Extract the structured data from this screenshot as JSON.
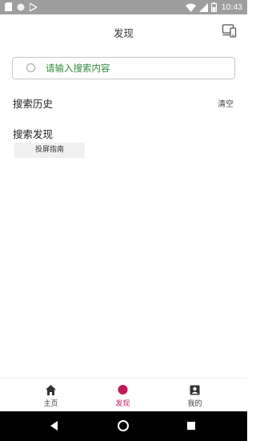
{
  "status_bar": {
    "time": "10:43",
    "left_icons": [
      "sd-card-icon",
      "circle-icon",
      "play-store-icon"
    ],
    "right_icons": [
      "wifi-icon",
      "signal-icon",
      "battery-icon"
    ]
  },
  "header": {
    "title": "发现",
    "action_icon": "cast-screen-icon"
  },
  "search": {
    "placeholder": "请输入搜索内容",
    "value": ""
  },
  "history": {
    "title": "搜索历史",
    "clear_label": "清空"
  },
  "discover": {
    "title": "搜索发现",
    "tags": [
      "投屏指南"
    ]
  },
  "bottom_nav": {
    "items": [
      {
        "label": "主页",
        "icon": "home-icon",
        "active": false
      },
      {
        "label": "发现",
        "icon": "discover-dot-icon",
        "active": true
      },
      {
        "label": "我的",
        "icon": "profile-icon",
        "active": false
      }
    ]
  },
  "colors": {
    "accent": "#c2185b",
    "placeholder_green": "#2e8b3a",
    "status_bar": "#9e9e9e",
    "system_nav": "#000000"
  }
}
